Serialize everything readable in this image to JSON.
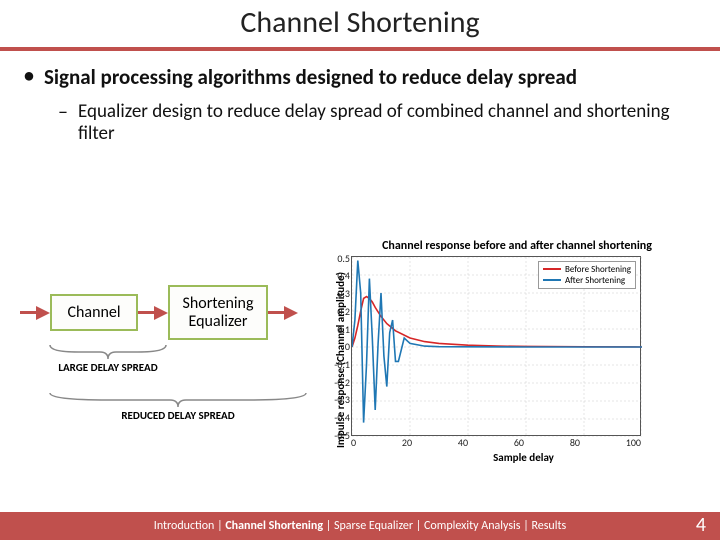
{
  "title": "Channel Shortening",
  "bullet1": "Signal processing algorithms designed to reduce delay spread",
  "bullet2": "Equalizer design to reduce delay spread of combined channel and shortening filter",
  "diagram": {
    "box1": "Channel",
    "box2": "Shortening Equalizer",
    "label_large": "LARGE DELAY SPREAD",
    "label_reduced": "REDUCED DELAY SPREAD"
  },
  "chart_data": {
    "type": "line",
    "title": "Channel response before and after channel shortening",
    "xlabel": "Sample delay",
    "ylabel": "Impulse response (Channel amplitude)",
    "xlim": [
      0,
      100
    ],
    "ylim": [
      -0.5,
      0.5
    ],
    "xticks": [
      0,
      20,
      40,
      60,
      80,
      100
    ],
    "yticks": [
      0.5,
      0.4,
      0.3,
      0.2,
      0.1,
      0,
      -0.1,
      -0.2,
      -0.3,
      -0.4,
      -0.5
    ],
    "series": [
      {
        "name": "Before Shortening",
        "color": "#d62728",
        "x": [
          0,
          1,
          2,
          3,
          4,
          5,
          6,
          7,
          8,
          10,
          12,
          15,
          20,
          25,
          30,
          40,
          50,
          60,
          80,
          100
        ],
        "y": [
          0,
          0.05,
          0.12,
          0.2,
          0.27,
          0.28,
          0.27,
          0.25,
          0.22,
          0.17,
          0.13,
          0.09,
          0.05,
          0.03,
          0.02,
          0.01,
          0.005,
          0.003,
          0.001,
          0
        ]
      },
      {
        "name": "After Shortening",
        "color": "#1f77b4",
        "x": [
          0,
          1,
          2,
          3,
          4,
          5,
          6,
          7,
          8,
          9,
          10,
          11,
          12,
          13,
          14,
          15,
          16,
          18,
          20,
          25,
          30,
          40,
          60,
          100
        ],
        "y": [
          0,
          0.15,
          0.48,
          0.3,
          -0.42,
          -0.1,
          0.38,
          0.05,
          -0.35,
          0.02,
          0.3,
          -0.05,
          -0.22,
          0.08,
          0.15,
          -0.08,
          -0.08,
          0.05,
          0.02,
          0.005,
          0.002,
          0.001,
          0,
          0
        ]
      }
    ]
  },
  "footer": {
    "sections": [
      "Introduction",
      "Channel Shortening",
      "Sparse Equalizer",
      "Complexity Analysis",
      "Results"
    ],
    "active": 1,
    "page": "4"
  }
}
